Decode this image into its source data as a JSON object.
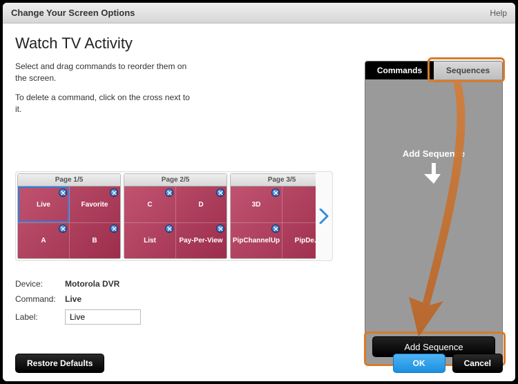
{
  "titlebar": {
    "title": "Change Your Screen Options",
    "help": "Help"
  },
  "page_title": "Watch TV Activity",
  "instructions": {
    "line1": "Select and drag commands to reorder them on the screen.",
    "line2": "To delete a command, click on the cross next to it."
  },
  "right_panel": {
    "tab_commands": "Commands",
    "tab_sequences": "Sequences",
    "hint": "Add Sequence",
    "add_button": "Add Sequence"
  },
  "carousel": {
    "pages": [
      {
        "header": "Page 1/5",
        "cells": [
          "Live",
          "Favorite",
          "A",
          "B"
        ]
      },
      {
        "header": "Page 2/5",
        "cells": [
          "C",
          "D",
          "List",
          "Pay-Per-View"
        ]
      },
      {
        "header": "Page 3/5",
        "cells": [
          "3D",
          "",
          "PipChannelUp",
          "PipDe..."
        ]
      }
    ]
  },
  "meta": {
    "device_label": "Device:",
    "device_value": "Motorola DVR",
    "command_label": "Command:",
    "command_value": "Live",
    "label_label": "Label:",
    "label_value": "Live"
  },
  "buttons": {
    "restore": "Restore Defaults",
    "ok": "OK",
    "cancel": "Cancel"
  }
}
